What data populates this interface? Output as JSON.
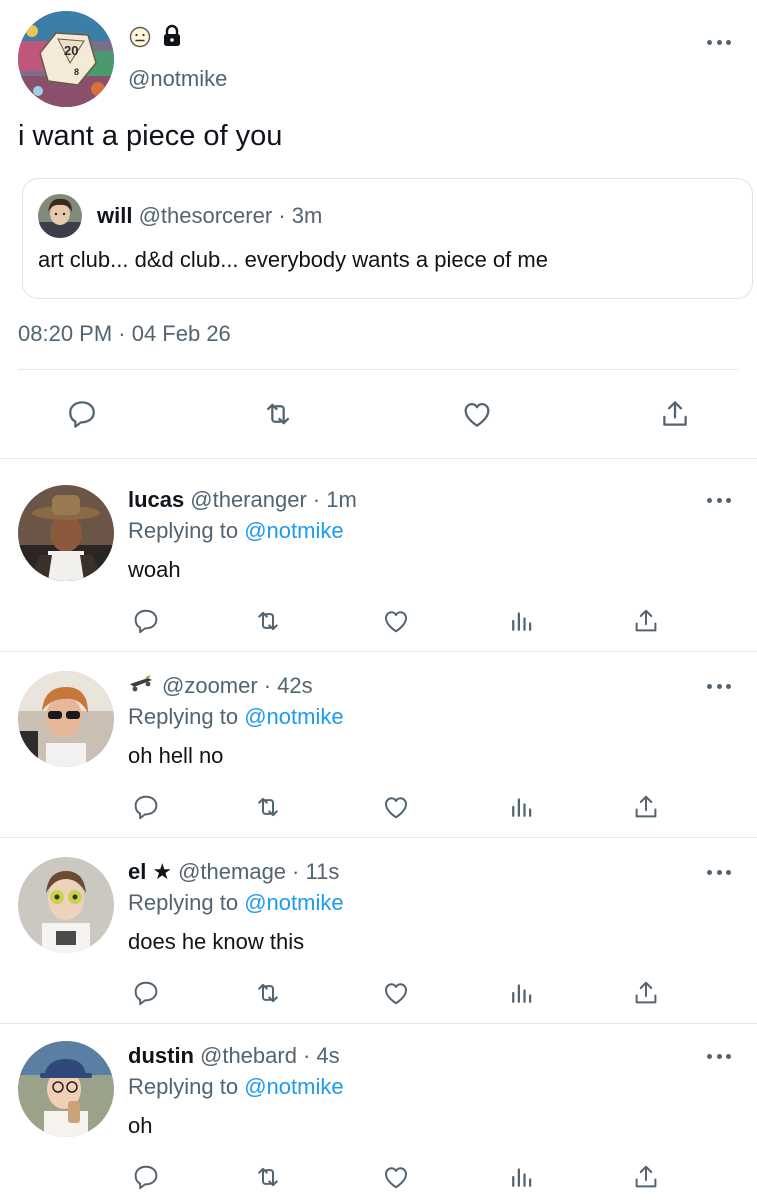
{
  "main_tweet": {
    "handle": "@notmike",
    "text": "i want a piece of you",
    "timestamp": "08:20 PM · 04 Feb 26",
    "badge_icons": [
      "neutral-face-emoji",
      "lock-icon"
    ],
    "avatar_die_label": "20",
    "quoted": {
      "name": "will",
      "handle": "@thesorcerer",
      "time": "· 3m",
      "text": "art club... d&d club... everybody wants a piece of me"
    }
  },
  "replies": [
    {
      "name": "lucas",
      "name_badge": "",
      "handle": "@theranger",
      "time": "· 1m",
      "replying_prefix": "Replying to",
      "replying_to": "@notmike",
      "text": "woah"
    },
    {
      "name": "",
      "name_badge": "skateboard-emoji",
      "handle": "@zoomer",
      "time": "· 42s",
      "replying_prefix": "Replying to",
      "replying_to": "@notmike",
      "text": "oh hell no"
    },
    {
      "name": "el",
      "name_badge": "★",
      "handle": "@themage",
      "time": "· 11s",
      "replying_prefix": "Replying to",
      "replying_to": "@notmike",
      "text": "does he know this"
    },
    {
      "name": "dustin",
      "name_badge": "",
      "handle": "@thebard",
      "time": "· 4s",
      "replying_prefix": "Replying to",
      "replying_to": "@notmike",
      "text": "oh"
    }
  ],
  "colors": {
    "link": "#1d9bf0",
    "muted": "#536471",
    "text": "#0f1419",
    "divider": "#e7e9ea"
  }
}
